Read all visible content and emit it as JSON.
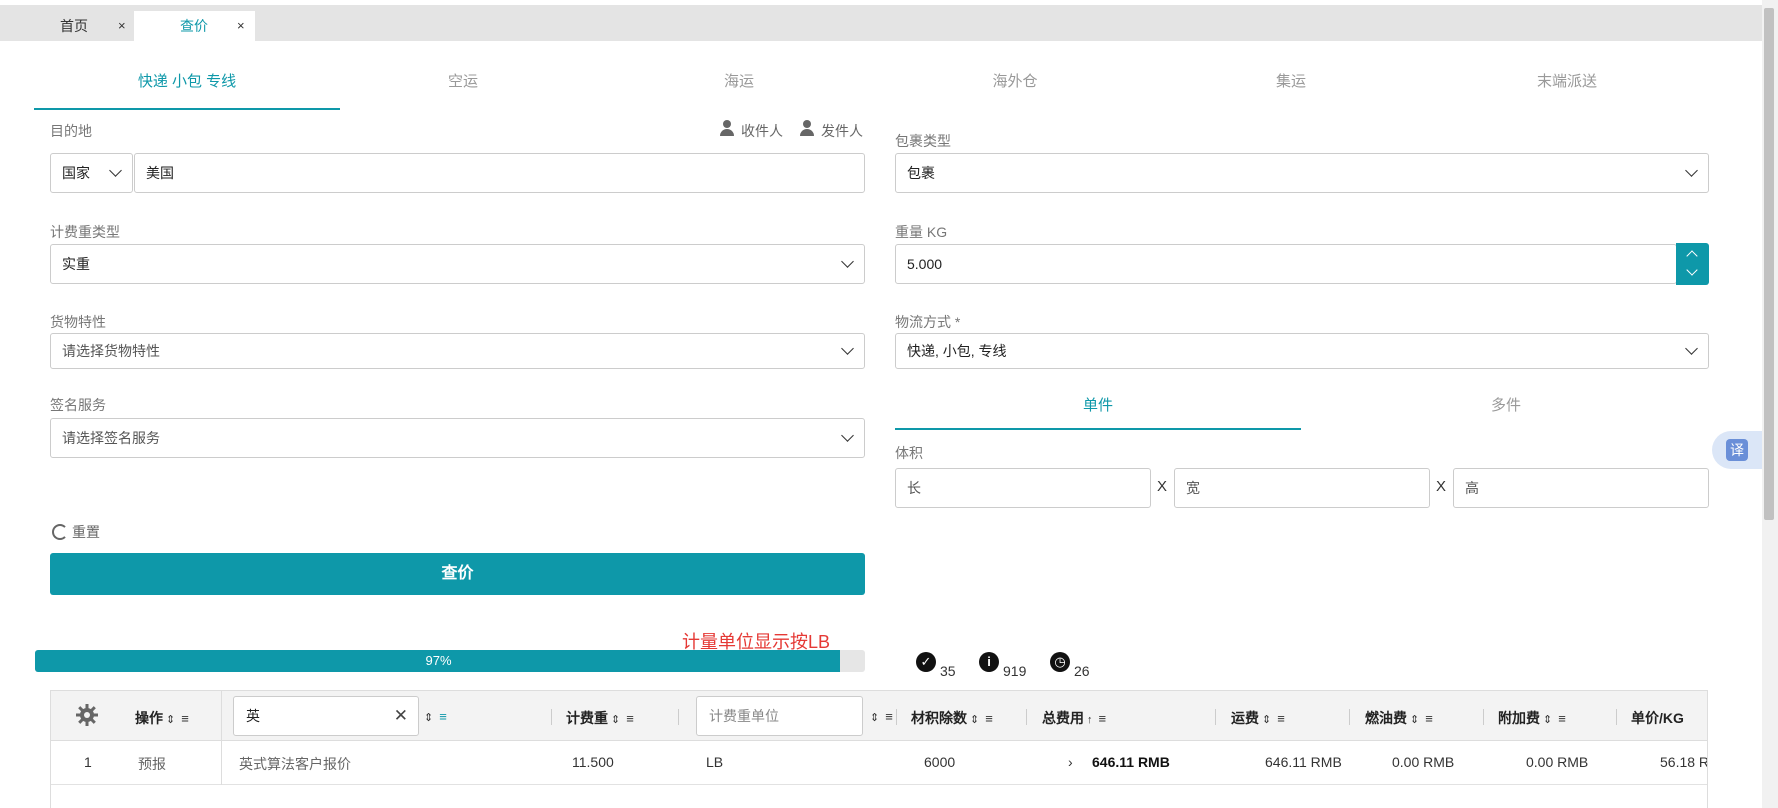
{
  "top_tabs": [
    {
      "label": "首页",
      "close": "×"
    },
    {
      "label": "查价",
      "close": "×"
    }
  ],
  "mode_tabs": [
    "快递 小包 专线",
    "空运",
    "海运",
    "海外仓",
    "集运",
    "末端派送"
  ],
  "form": {
    "destination_label": "目的地",
    "recipient": "收件人",
    "sender": "发件人",
    "country_select": "国家",
    "country_value": "美国",
    "package_type_label": "包裹类型",
    "package_type_value": "包裹",
    "charge_weight_type_label": "计费重类型",
    "charge_weight_type_value": "实重",
    "weight_label": "重量 KG",
    "weight_value": "5.000",
    "cargo_label": "货物特性",
    "cargo_placeholder": "请选择货物特性",
    "logistics_label": "物流方式 *",
    "logistics_value": "快递, 小包, 专线",
    "signature_label": "签名服务",
    "signature_placeholder": "请选择签名服务",
    "piece_tabs": [
      "单件",
      "多件"
    ],
    "volume_label": "体积",
    "length_ph": "长",
    "width_ph": "宽",
    "height_ph": "高",
    "times": "X",
    "reset": "重置",
    "query_button": "查价"
  },
  "note": "计量单位显示按LB",
  "progress": {
    "percent": 97,
    "label": "97%"
  },
  "stats": {
    "success": "35",
    "info": "919",
    "pending": "26"
  },
  "table": {
    "headers": {
      "action": "操作",
      "name_filter_value": "英",
      "charge_weight": "计费重",
      "unit_filter_placeholder": "计费重单位",
      "divisor": "材积除数",
      "total": "总费用",
      "freight": "运费",
      "fuel": "燃油费",
      "surcharge": "附加费",
      "unit_price": "单价/KG"
    },
    "rows": [
      {
        "index": "1",
        "action": "预报",
        "name": "英式算法客户报价",
        "charge_weight": "11.500",
        "unit": "LB",
        "divisor": "6000",
        "total": "646.11 RMB",
        "freight": "646.11 RMB",
        "fuel": "0.00 RMB",
        "surcharge": "0.00 RMB",
        "unit_price": "56.18 R"
      }
    ]
  },
  "translate_badge": "译",
  "colors": {
    "accent": "#0e98a9",
    "note": "#e53935"
  }
}
